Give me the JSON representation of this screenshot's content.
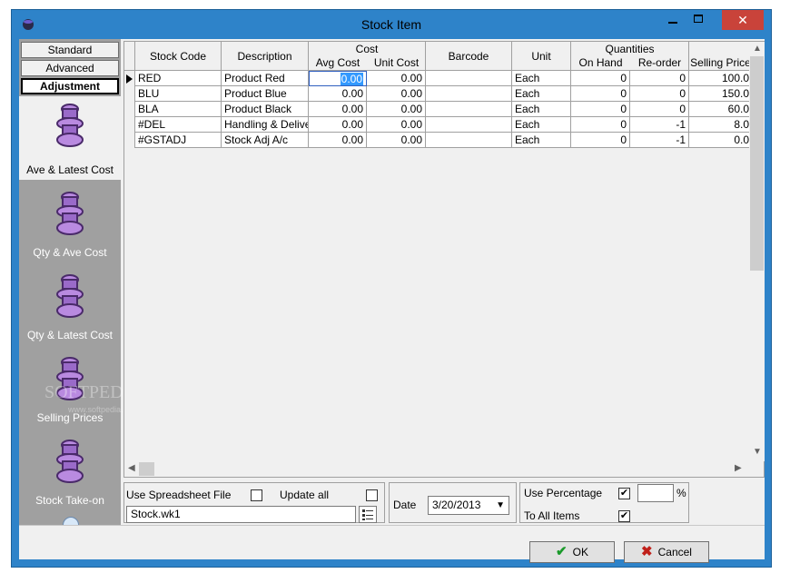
{
  "window": {
    "title": "Stock Item",
    "close_glyph": "✕"
  },
  "sidebar": {
    "modes": [
      {
        "label": "Standard"
      },
      {
        "label": "Advanced"
      },
      {
        "label": "Adjustment"
      }
    ],
    "items": [
      {
        "label": "Ave & Latest Cost",
        "icon": "stack-icon"
      },
      {
        "label": "Qty & Ave Cost",
        "icon": "stack-icon"
      },
      {
        "label": "Qty & Latest Cost",
        "icon": "stack-icon"
      },
      {
        "label": "Selling Prices",
        "icon": "stack-icon"
      },
      {
        "label": "Stock Take-on",
        "icon": "stack-icon"
      }
    ]
  },
  "grid": {
    "headers": {
      "stock_code": "Stock Code",
      "description": "Description",
      "cost": "Cost",
      "avg_cost": "Avg Cost",
      "unit_cost": "Unit Cost",
      "barcode": "Barcode",
      "unit": "Unit",
      "quantities": "Quantities",
      "on_hand": "On Hand",
      "reorder": "Re-order",
      "selling_price": "Selling Price"
    },
    "rows": [
      {
        "code": "RED",
        "desc": "Product Red",
        "avg": "0.00",
        "unit_cost": "0.00",
        "barcode": "",
        "unit": "Each",
        "on_hand": "0",
        "reorder": "0",
        "price": "100.0"
      },
      {
        "code": "BLU",
        "desc": "Product Blue",
        "avg": "0.00",
        "unit_cost": "0.00",
        "barcode": "",
        "unit": "Each",
        "on_hand": "0",
        "reorder": "0",
        "price": "150.0"
      },
      {
        "code": "BLA",
        "desc": "Product Black",
        "avg": "0.00",
        "unit_cost": "0.00",
        "barcode": "",
        "unit": "Each",
        "on_hand": "0",
        "reorder": "0",
        "price": "60.0"
      },
      {
        "code": "#DEL",
        "desc": "Handling & Delivery",
        "avg": "0.00",
        "unit_cost": "0.00",
        "barcode": "",
        "unit": "Each",
        "on_hand": "0",
        "reorder": "-1",
        "price": "8.0"
      },
      {
        "code": "#GSTADJ",
        "desc": "Stock Adj A/c",
        "avg": "0.00",
        "unit_cost": "0.00",
        "barcode": "",
        "unit": "Each",
        "on_hand": "0",
        "reorder": "-1",
        "price": "0.0"
      }
    ]
  },
  "options": {
    "use_spreadsheet_label": "Use Spreadsheet File",
    "use_spreadsheet_checked": false,
    "update_all_label": "Update all",
    "update_all_checked": false,
    "file_value": "Stock.wk1",
    "date_label": "Date",
    "date_value": "3/20/2013",
    "use_percentage_label": "Use Percentage",
    "use_percentage_checked": true,
    "percentage_value": "",
    "percent_sign": "%",
    "to_all_items_label": "To All Items",
    "to_all_items_checked": true
  },
  "footer": {
    "ok_label": "OK",
    "cancel_label": "Cancel"
  },
  "watermark": {
    "text": "SOFTPEDIA",
    "url": "www.softpedia.com"
  }
}
